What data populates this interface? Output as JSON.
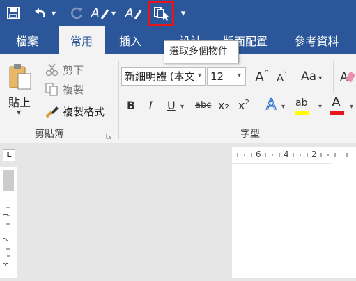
{
  "app": {
    "accent": "#2b579a",
    "highlight_box_color": "#e8141c"
  },
  "quick_access": {
    "icons": [
      "save-icon",
      "undo-icon",
      "redo-icon",
      "format-painter-icon",
      "clear-format-icon",
      "select-objects-icon",
      "customize-dropdown-icon"
    ],
    "customize_glyph": "▾"
  },
  "tabs": [
    "檔案",
    "常用",
    "插入",
    "設計",
    "版面配置",
    "參考資料"
  ],
  "tooltip": "選取多個物件",
  "clipboard": {
    "paste": "貼上",
    "paste_arrow": "▾",
    "cut": "剪下",
    "copy": "複製",
    "format_painter": "複製格式",
    "group_label": "剪貼簿"
  },
  "font": {
    "font_name": "新細明體 (本文",
    "font_size": "12",
    "grow": "A",
    "shrink": "A",
    "change_case": "Aa",
    "bold": "B",
    "italic": "I",
    "underline": "U",
    "strike": "abc",
    "subscript": "x",
    "subscript_mark": "2",
    "superscript": "x",
    "superscript_mark": "2",
    "text_effects": "A",
    "highlight": "ab",
    "font_color": "A",
    "group_label": "字型"
  },
  "ruler": {
    "tab_selector": "L",
    "h_ticks": [
      "6",
      "4",
      "2"
    ],
    "v_ticks": [
      "1",
      "2",
      "3"
    ]
  }
}
